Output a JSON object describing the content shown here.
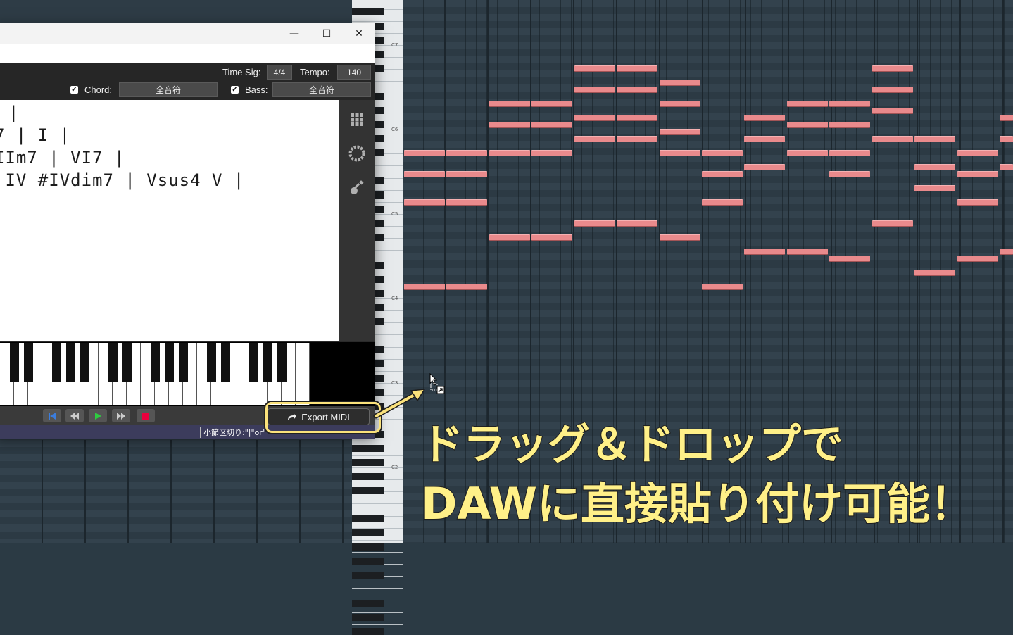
{
  "window": {
    "minimize_glyph": "—",
    "maximize_glyph": "☐",
    "close_glyph": "✕"
  },
  "controls": {
    "time_sig_label": "Time Sig:",
    "time_sig_value": "4/4",
    "tempo_label": "Tempo:",
    "tempo_value": "140",
    "chord_label": "Chord:",
    "chord_value": "全音符",
    "chord_checked": true,
    "bass_label": "Bass:",
    "bass_value": "全音符",
    "bass_checked": true
  },
  "editor": {
    "lines": [
      "|",
      "7 | I |",
      "IIm7 | VI7 |",
      " IV #IVdim7 | Vsus4 V |"
    ]
  },
  "side_tools": [
    "grid-icon",
    "circle-of-fifths-icon",
    "guitar-icon"
  ],
  "transport": {
    "buttons": [
      "skip-to-start-icon",
      "rewind-icon",
      "play-icon",
      "fast-forward-icon",
      "stop-icon"
    ],
    "export_label": "Export MIDI"
  },
  "status": {
    "text": "小節区切り:\"|\"or\""
  },
  "piano_roll": {
    "octave_labels": [
      "C7",
      "C6",
      "C5",
      "C4",
      "C3",
      "C2"
    ]
  },
  "captions": {
    "line1": "ドラッグ＆ドロップで",
    "line2": "DAWに直接貼り付け可能！"
  },
  "colors": {
    "note": "#e98a8c",
    "caption": "#fff088",
    "accent_play": "#2ecc40",
    "accent_stop": "#e8003d",
    "accent_skip": "#3b7ddd"
  }
}
